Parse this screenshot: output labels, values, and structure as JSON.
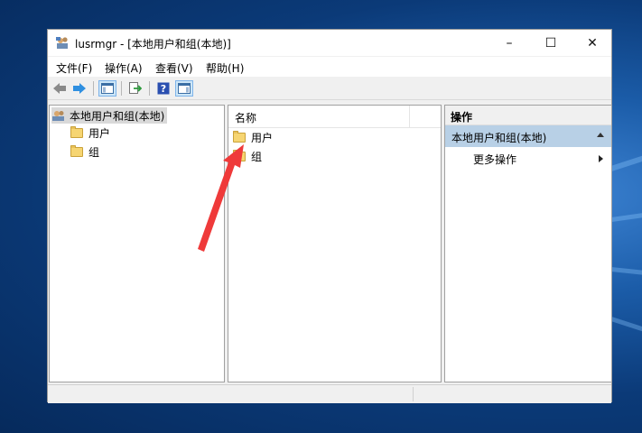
{
  "window": {
    "title": "lusrmgr - [本地用户和组(本地)]",
    "minimize_glyph": "–",
    "maximize_glyph": "☐",
    "close_glyph": "✕"
  },
  "menu": {
    "file": "文件(F)",
    "action": "操作(A)",
    "view": "查看(V)",
    "help": "帮助(H)"
  },
  "toolbar": {
    "icons": [
      "back-arrow-icon",
      "forward-arrow-icon",
      "show-hide-console-tree-icon",
      "export-list-icon",
      "help-icon",
      "show-hide-action-pane-icon"
    ]
  },
  "tree": {
    "root_label": "本地用户和组(本地)",
    "items": [
      {
        "label": "用户"
      },
      {
        "label": "组"
      }
    ]
  },
  "list": {
    "column_name": "名称",
    "rows": [
      {
        "label": "用户"
      },
      {
        "label": "组"
      }
    ]
  },
  "actions": {
    "header": "操作",
    "section": "本地用户和组(本地)",
    "more_actions": "更多操作"
  },
  "colors": {
    "selection_gray": "#d9d9d9",
    "action_section_blue": "#b8d0e6",
    "annotation_red": "#ef3a3a",
    "folder_yellow": "#f6d572"
  }
}
